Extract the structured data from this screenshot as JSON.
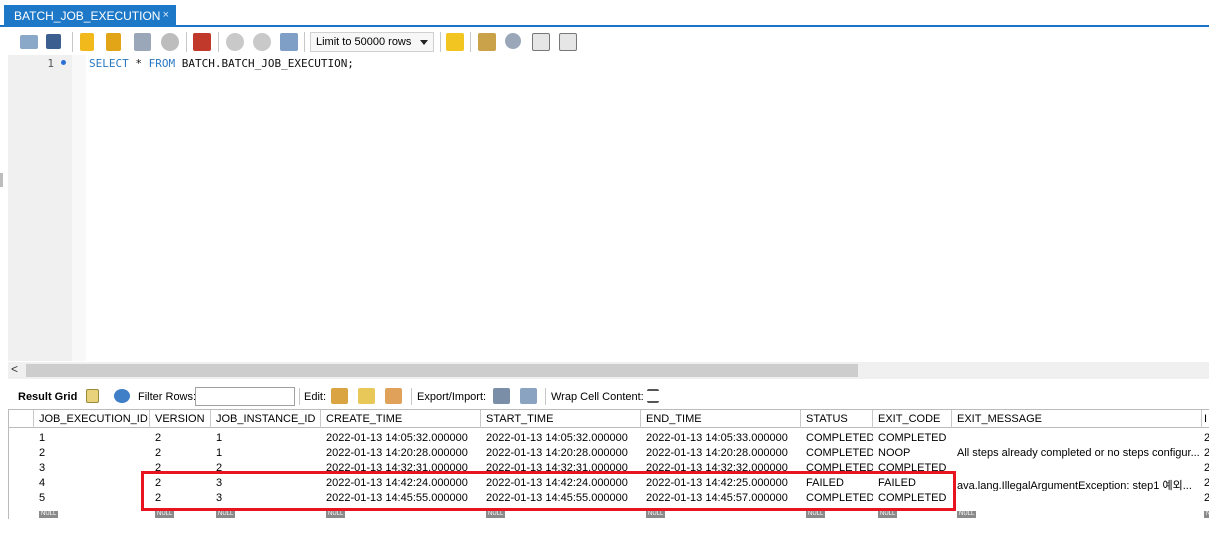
{
  "tab": {
    "title": "BATCH_JOB_EXECUTION",
    "close": "×"
  },
  "toolbar": {
    "icons": [
      "open-folder-icon",
      "save-icon",
      "execute-icon",
      "execute-current-icon",
      "explain-icon",
      "stop-icon",
      "toggle-error-icon",
      "commit-icon",
      "rollback-icon",
      "autocommit-icon",
      "favorite-icon",
      "beautify-icon",
      "find-icon",
      "invisible-chars-icon",
      "wrap-icon"
    ],
    "limit_label": "Limit to 50000 rows"
  },
  "editor": {
    "line_number": "1",
    "sql_keyword_1": "SELECT",
    "sql_star": " * ",
    "sql_keyword_2": "FROM",
    "sql_object": " BATCH.BATCH_JOB_EXECUTION;"
  },
  "scroll": {
    "left_arrow": "<"
  },
  "result_toolbar": {
    "result_grid": "Result Grid",
    "filter_rows": "Filter Rows:",
    "edit": "Edit:",
    "export_import": "Export/Import:",
    "wrap_cell": "Wrap Cell Content:"
  },
  "grid": {
    "columns": [
      "JOB_EXECUTION_ID",
      "VERSION",
      "JOB_INSTANCE_ID",
      "CREATE_TIME",
      "START_TIME",
      "END_TIME",
      "STATUS",
      "EXIT_CODE",
      "EXIT_MESSAGE",
      "I"
    ],
    "rows": [
      [
        "1",
        "2",
        "1",
        "2022-01-13 14:05:32.000000",
        "2022-01-13 14:05:32.000000",
        "2022-01-13 14:05:33.000000",
        "COMPLETED",
        "COMPLETED",
        "",
        "2"
      ],
      [
        "2",
        "2",
        "1",
        "2022-01-13 14:20:28.000000",
        "2022-01-13 14:20:28.000000",
        "2022-01-13 14:20:28.000000",
        "COMPLETED",
        "NOOP",
        "All steps already completed or no steps configur...",
        "2"
      ],
      [
        "3",
        "2",
        "2",
        "2022-01-13 14:32:31.000000",
        "2022-01-13 14:32:31.000000",
        "2022-01-13 14:32:32.000000",
        "COMPLETED",
        "COMPLETED",
        "",
        "2"
      ],
      [
        "4",
        "2",
        "3",
        "2022-01-13 14:42:24.000000",
        "2022-01-13 14:42:24.000000",
        "2022-01-13 14:42:25.000000",
        "FAILED",
        "FAILED",
        "ava.lang.IllegalArgumentException: step1 예외...",
        "2"
      ],
      [
        "5",
        "2",
        "3",
        "2022-01-13 14:45:55.000000",
        "2022-01-13 14:45:55.000000",
        "2022-01-13 14:45:57.000000",
        "COMPLETED",
        "COMPLETED",
        "",
        "2"
      ]
    ],
    "null_label": "NULL"
  },
  "colors": {
    "tab": "#1e78c8",
    "keyword": "#2a78c2",
    "highlight": "#e8141f"
  }
}
